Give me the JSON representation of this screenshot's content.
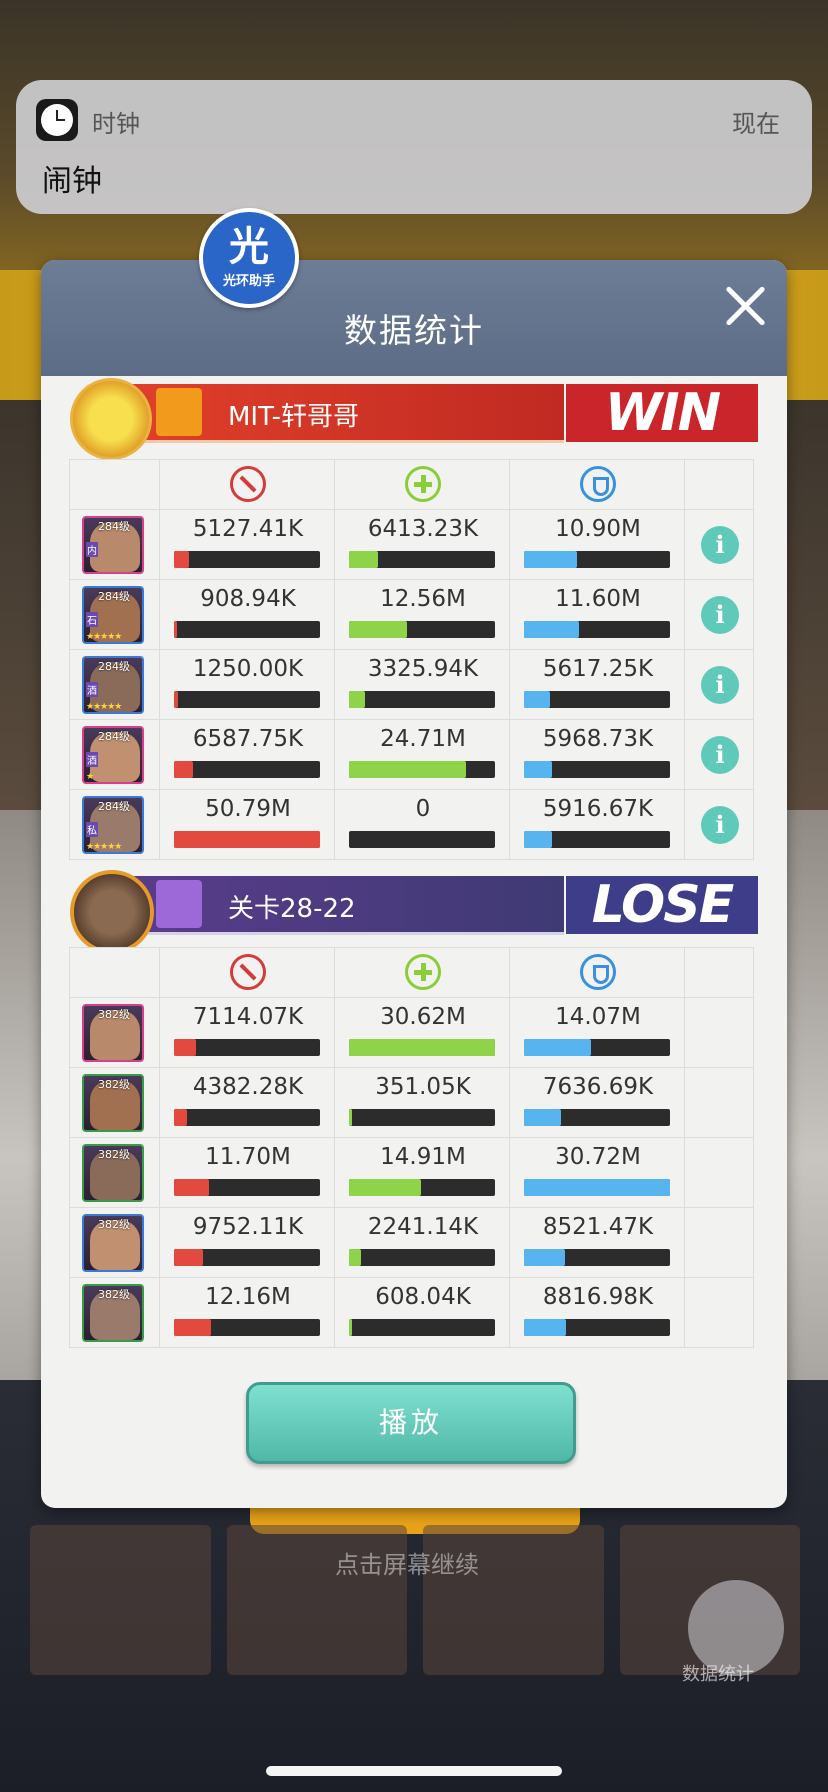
{
  "notification": {
    "app_name": "时钟",
    "time": "现在",
    "message": "闹钟",
    "icon": "clock-icon"
  },
  "logo": {
    "char": "光",
    "label": "光环助手"
  },
  "dialog": {
    "title": "数据统计",
    "play_label": "播放"
  },
  "team_win": {
    "name": "MIT-轩哥哥",
    "result": "WIN",
    "color": "#c9252a",
    "heroes": [
      {
        "level": "284级",
        "tag": "内",
        "stars": "",
        "damage": "5127.41K",
        "heal": "6413.23K",
        "shield": "10.90M",
        "damage_pct": 10,
        "heal_pct": 20,
        "shield_pct": 36
      },
      {
        "level": "284级",
        "tag": "石",
        "stars": "★★★★★",
        "damage": "908.94K",
        "heal": "12.56M",
        "shield": "11.60M",
        "damage_pct": 2,
        "heal_pct": 40,
        "shield_pct": 38
      },
      {
        "level": "284级",
        "tag": "酒",
        "stars": "★★★★★",
        "damage": "1250.00K",
        "heal": "3325.94K",
        "shield": "5617.25K",
        "damage_pct": 3,
        "heal_pct": 11,
        "shield_pct": 18
      },
      {
        "level": "284级",
        "tag": "酒",
        "stars": "★",
        "damage": "6587.75K",
        "heal": "24.71M",
        "shield": "5968.73K",
        "damage_pct": 13,
        "heal_pct": 80,
        "shield_pct": 19
      },
      {
        "level": "284级",
        "tag": "私",
        "stars": "★★★★★",
        "damage": "50.79M",
        "heal": "0",
        "shield": "5916.67K",
        "damage_pct": 100,
        "heal_pct": 0,
        "shield_pct": 19
      }
    ]
  },
  "team_lose": {
    "name": "关卡28-22",
    "result": "LOSE",
    "color": "#3e3d8a",
    "heroes": [
      {
        "level": "382级",
        "damage": "7114.07K",
        "heal": "30.62M",
        "shield": "14.07M",
        "damage_pct": 15,
        "heal_pct": 100,
        "shield_pct": 46
      },
      {
        "level": "382级",
        "damage": "4382.28K",
        "heal": "351.05K",
        "shield": "7636.69K",
        "damage_pct": 9,
        "heal_pct": 2,
        "shield_pct": 25
      },
      {
        "level": "382级",
        "damage": "11.70M",
        "heal": "14.91M",
        "shield": "30.72M",
        "damage_pct": 24,
        "heal_pct": 49,
        "shield_pct": 100
      },
      {
        "level": "382级",
        "damage": "9752.11K",
        "heal": "2241.14K",
        "shield": "8521.47K",
        "damage_pct": 20,
        "heal_pct": 8,
        "shield_pct": 28
      },
      {
        "level": "382级",
        "damage": "12.16M",
        "heal": "608.04K",
        "shield": "8816.98K",
        "damage_pct": 25,
        "heal_pct": 2,
        "shield_pct": 29
      }
    ]
  },
  "icons": {
    "damage": "damage-icon",
    "heal": "heal-icon",
    "shield": "shield-icon",
    "info": "info-icon"
  },
  "background": {
    "tap_hint": "点击屏幕继续",
    "stats_button": "数据统计"
  }
}
